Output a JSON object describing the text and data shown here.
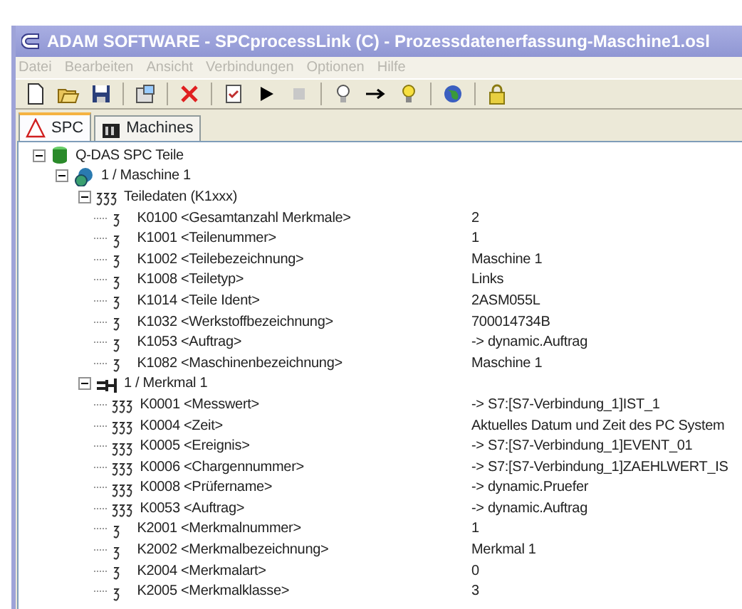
{
  "window": {
    "title": "ADAM SOFTWARE - SPCprocessLink (C)  -  Prozessdatenerfassung-Maschine1.osl"
  },
  "menu": [
    "Datei",
    "Bearbeiten",
    "Ansicht",
    "Verbindungen",
    "Optionen",
    "Hilfe"
  ],
  "tabs": [
    {
      "label": "SPC",
      "selected": true,
      "kind": "warning"
    },
    {
      "label": "Machines",
      "selected": false,
      "kind": "machine"
    }
  ],
  "tree": [
    {
      "label": "Q-DAS SPC Teile",
      "kind": "database",
      "expanded": true,
      "children": [
        {
          "label": "1 / Maschine 1",
          "kind": "machine",
          "expanded": true,
          "children": [
            {
              "label": "Teiledaten (K1xxx)",
              "kind": "group",
              "expanded": true,
              "children": [
                {
                  "label": "K0100 <Gesamtanzahl Merkmale>",
                  "value": "2",
                  "kind": "field"
                },
                {
                  "label": "K1001 <Teilenummer>",
                  "value": "1",
                  "kind": "field"
                },
                {
                  "label": "K1002 <Teilebezeichnung>",
                  "value": "Maschine 1",
                  "kind": "field"
                },
                {
                  "label": "K1008 <Teiletyp>",
                  "value": "Links",
                  "kind": "field"
                },
                {
                  "label": "K1014 <Teile Ident>",
                  "value": "2ASM055L",
                  "kind": "field"
                },
                {
                  "label": "K1032 <Werkstoffbezeichnung>",
                  "value": "700014734B",
                  "kind": "field"
                },
                {
                  "label": "K1053 <Auftrag>",
                  "value": "-> dynamic.Auftrag",
                  "kind": "field"
                },
                {
                  "label": "K1082 <Maschinenbezeichnung>",
                  "value": "Maschine 1",
                  "kind": "field"
                }
              ]
            },
            {
              "label": "1 / Merkmal 1",
              "kind": "feature",
              "expanded": true,
              "children": [
                {
                  "label": "K0001 <Messwert>",
                  "value": "-> S7:[S7-Verbindung_1]IST_1",
                  "kind": "multi"
                },
                {
                  "label": "K0004 <Zeit>",
                  "value": "Aktuelles Datum und Zeit des PC System",
                  "kind": "multi"
                },
                {
                  "label": "K0005 <Ereignis>",
                  "value": "-> S7:[S7-Verbindung_1]EVENT_01",
                  "kind": "multi"
                },
                {
                  "label": "K0006 <Chargennummer>",
                  "value": "-> S7:[S7-Verbindung_1]ZAEHLWERT_IS",
                  "kind": "multi"
                },
                {
                  "label": "K0008 <Prüfername>",
                  "value": "-> dynamic.Pruefer",
                  "kind": "multi"
                },
                {
                  "label": "K0053 <Auftrag>",
                  "value": "-> dynamic.Auftrag",
                  "kind": "multi"
                },
                {
                  "label": "K2001 <Merkmalnummer>",
                  "value": "1",
                  "kind": "field"
                },
                {
                  "label": "K2002 <Merkmalbezeichnung>",
                  "value": "Merkmal 1",
                  "kind": "field"
                },
                {
                  "label": "K2004 <Merkmalart>",
                  "value": "0",
                  "kind": "field"
                },
                {
                  "label": "K2005 <Merkmalklasse>",
                  "value": "3",
                  "kind": "field"
                }
              ]
            }
          ]
        }
      ]
    }
  ]
}
